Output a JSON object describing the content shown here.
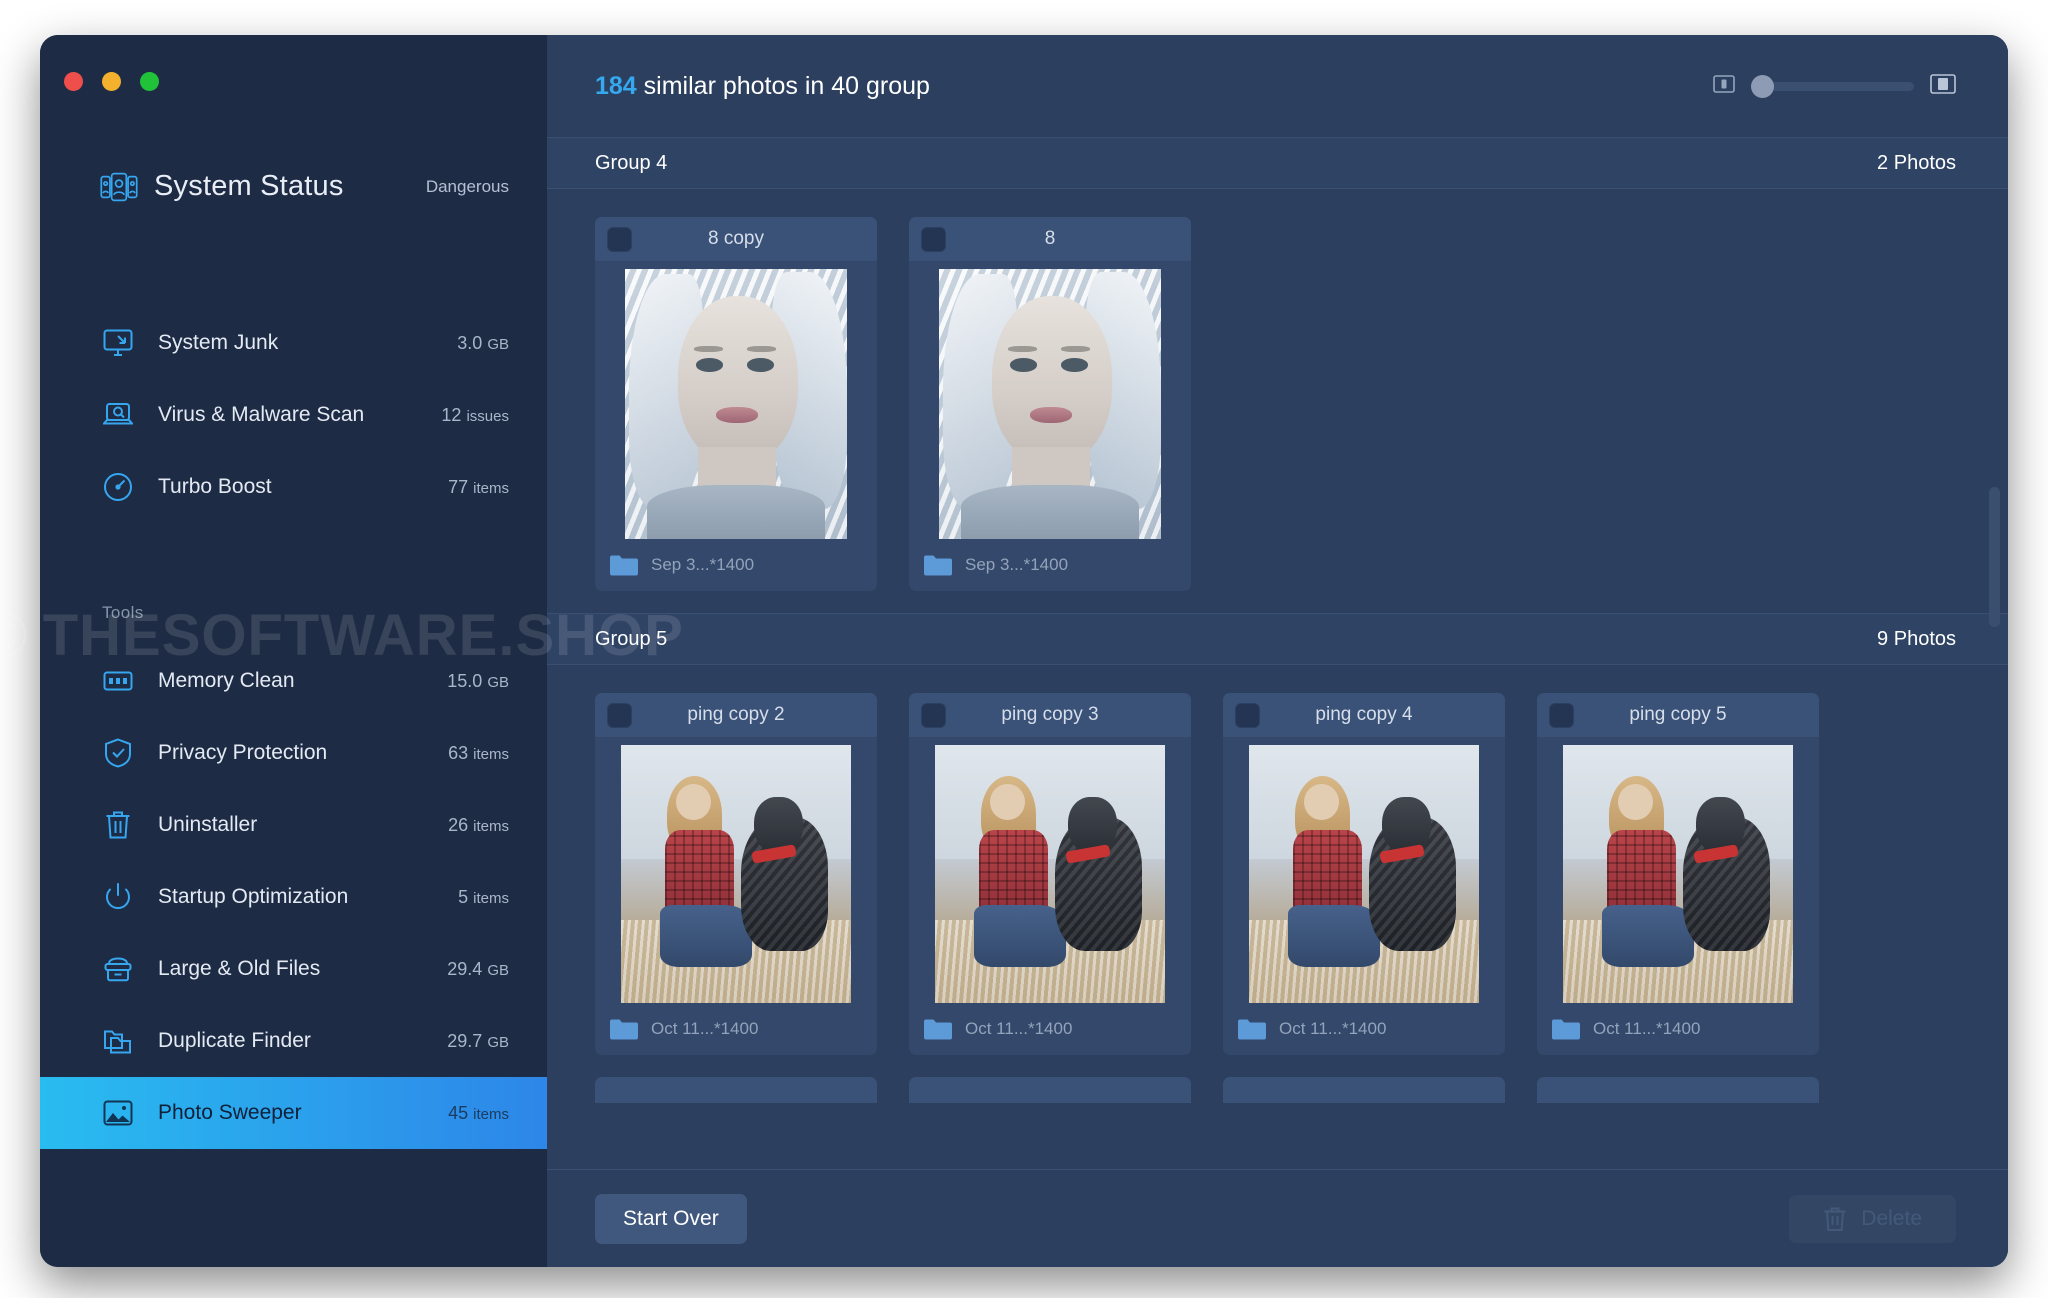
{
  "window": {
    "traffic_lights": [
      "close",
      "minimize",
      "maximize"
    ],
    "colors": {
      "close": "#ef4f4a",
      "minimize": "#f3b12e",
      "maximize": "#21c13a",
      "accent": "#35a8ef",
      "active_gradient_start": "#29bcf0",
      "active_gradient_end": "#2d86e8",
      "sidebar_bg": "#1d2b44",
      "main_bg": "#2c3f5e"
    }
  },
  "sidebar": {
    "status": {
      "icon": "system-status-icon",
      "title": "System Status",
      "value": "Dangerous"
    },
    "primary_items": [
      {
        "icon": "system-junk-icon",
        "label": "System Junk",
        "value": "3.0",
        "unit": "GB"
      },
      {
        "icon": "virus-scan-icon",
        "label": "Virus & Malware Scan",
        "value": "12",
        "unit": "issues"
      },
      {
        "icon": "turbo-boost-icon",
        "label": "Turbo Boost",
        "value": "77",
        "unit": "items"
      }
    ],
    "tools_heading": "Tools",
    "tools_items": [
      {
        "icon": "memory-clean-icon",
        "label": "Memory Clean",
        "value": "15.0",
        "unit": "GB",
        "active": false
      },
      {
        "icon": "privacy-protection-icon",
        "label": "Privacy Protection",
        "value": "63",
        "unit": "items",
        "active": false
      },
      {
        "icon": "uninstaller-icon",
        "label": "Uninstaller",
        "value": "26",
        "unit": "items",
        "active": false
      },
      {
        "icon": "startup-optimization-icon",
        "label": "Startup Optimization",
        "value": "5",
        "unit": "items",
        "active": false
      },
      {
        "icon": "large-old-files-icon",
        "label": "Large & Old Files",
        "value": "29.4",
        "unit": "GB",
        "active": false
      },
      {
        "icon": "duplicate-finder-icon",
        "label": "Duplicate Finder",
        "value": "29.7",
        "unit": "GB",
        "active": false
      },
      {
        "icon": "photo-sweeper-icon",
        "label": "Photo Sweeper",
        "value": "45",
        "unit": "items",
        "active": true
      }
    ]
  },
  "watermark": {
    "copyright": "©",
    "text": "THESOFTWARE.SHOP"
  },
  "main": {
    "header": {
      "count": "184",
      "text": "similar photos in 40 group"
    },
    "size_slider": {
      "small_icon": "small-thumbnail-icon",
      "large_icon": "large-thumbnail-icon",
      "value": 0
    },
    "groups": [
      {
        "name": "Group 4",
        "photo_count": "2 Photos",
        "photos": [
          {
            "title": "8 copy",
            "date": "Sep 3...*1400",
            "art": "portrait",
            "checked": false
          },
          {
            "title": "8",
            "date": "Sep 3...*1400",
            "art": "portrait",
            "checked": false
          }
        ]
      },
      {
        "name": "Group 5",
        "photo_count": "9 Photos",
        "photos": [
          {
            "title": "ping copy 2",
            "date": "Oct 11...*1400",
            "art": "dog",
            "checked": false
          },
          {
            "title": "ping copy 3",
            "date": "Oct 11...*1400",
            "art": "dog",
            "checked": false
          },
          {
            "title": "ping copy 4",
            "date": "Oct 11...*1400",
            "art": "dog",
            "checked": false
          },
          {
            "title": "ping copy 5",
            "date": "Oct 11...*1400",
            "art": "dog",
            "checked": false
          }
        ]
      }
    ],
    "footer": {
      "start_over_label": "Start Over",
      "delete_label": "Delete",
      "delete_icon": "trash-icon",
      "delete_disabled": true
    }
  }
}
